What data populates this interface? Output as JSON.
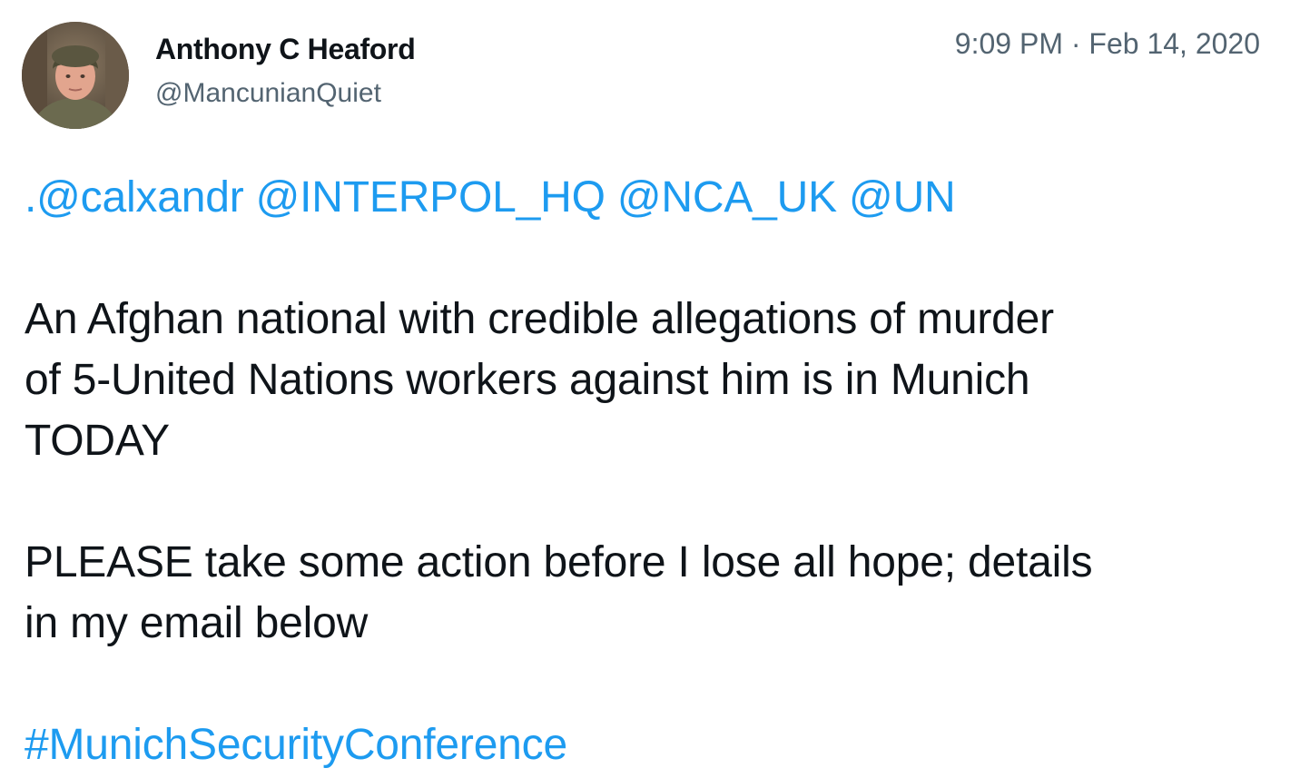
{
  "author": {
    "name": "Anthony C Heaford",
    "handle": "@MancunianQuiet",
    "avatar_icon": "user-avatar-photo"
  },
  "timestamp": "9:09 PM · Feb 14, 2020",
  "tweet": {
    "mention_prefix": ".",
    "mentions": [
      "@calxandr",
      "@INTERPOL_HQ",
      "@NCA_UK",
      "@UN"
    ],
    "paragraph_1_line_1": "An Afghan national with credible allegations of murder",
    "paragraph_1_line_2": "of 5-United Nations workers against him is in Munich",
    "paragraph_1_line_3": "TODAY",
    "paragraph_2_line_1": "PLEASE take some action before I lose all hope; details",
    "paragraph_2_line_2": "in my email below",
    "hashtag": "#MunichSecurityConference"
  },
  "colors": {
    "link": "#1d9bf0",
    "text": "#0f1419",
    "secondary": "#536471"
  }
}
